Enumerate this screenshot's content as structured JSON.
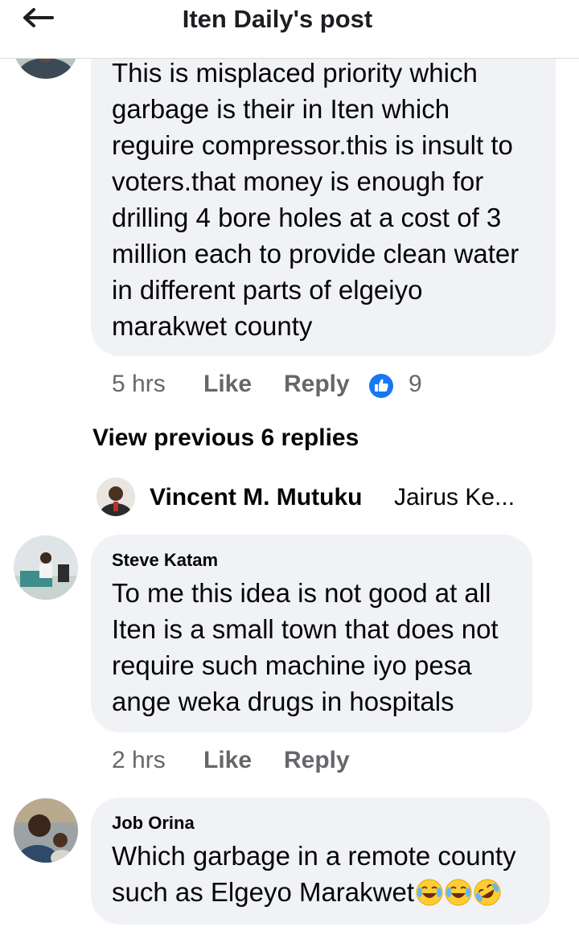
{
  "header": {
    "title": "Iten Daily's post"
  },
  "comments": [
    {
      "text_lines": [
        "This is misplaced priority which",
        "garbage is their in Iten which",
        "reguire compressor.this is insult to",
        "voters.that money is enough for",
        "drilling 4 bore holes at a cost of 3",
        "million each to provide clean water",
        "in different parts of elgeiyo",
        "marakwet county"
      ],
      "time": "5 hrs",
      "like_label": "Like",
      "reply_label": "Reply",
      "reaction_count": "9"
    },
    {
      "author": "Steve Katam",
      "text_lines": [
        "To me this idea is not good at all",
        "Iten is a small town that does not",
        "require such machine iyo pesa",
        "ange weka drugs in hospitals"
      ],
      "time": "2 hrs",
      "like_label": "Like",
      "reply_label": "Reply"
    },
    {
      "author": "Job Orina",
      "text_lines": [
        "Which garbage in a remote county",
        "such as Elgeyo Marakwet"
      ],
      "emojis": [
        "face-with-tears-of-joy",
        "face-with-tears-of-joy",
        "rolling-on-floor-laughing"
      ]
    }
  ],
  "view_previous": "View previous 6 replies",
  "reply_preview": {
    "name": "Vincent M. Mutuku",
    "text": "Jairus Ke..."
  },
  "colors": {
    "like_blue": "#1877f2",
    "bubble_bg": "#f0f2f5",
    "meta_gray": "#65676b"
  },
  "icons": {
    "back": "arrow-left-icon",
    "reaction": "thumbs-up-icon"
  }
}
